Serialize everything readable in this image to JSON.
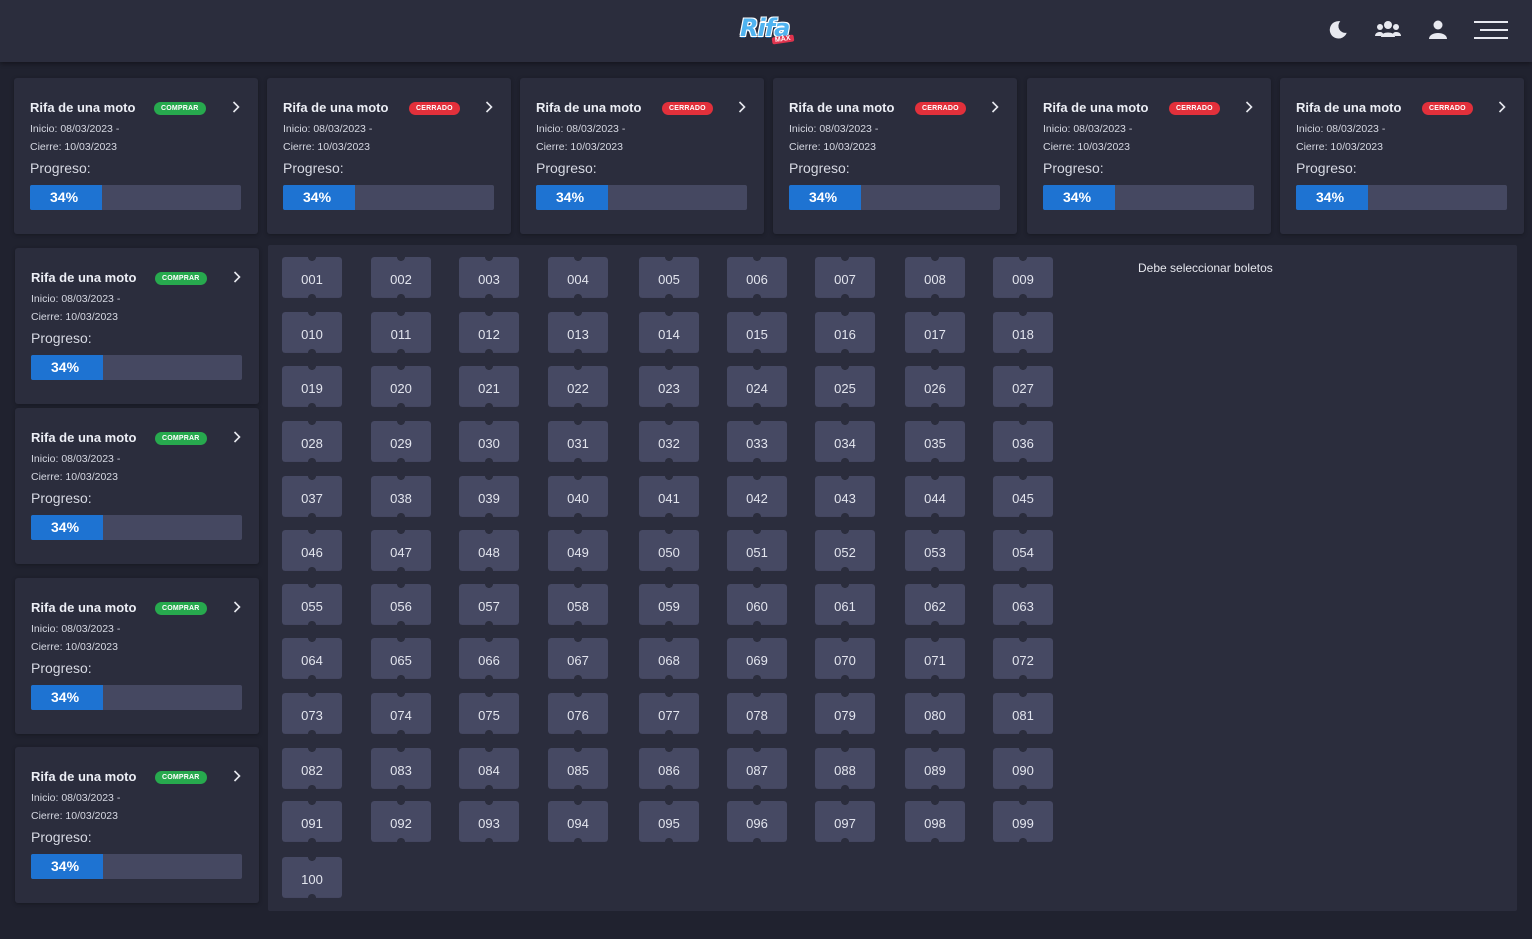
{
  "brand": {
    "logo_text": "Rifa",
    "logo_sub": "MAX"
  },
  "nav": {
    "icons": [
      "moon-icon",
      "users-icon",
      "user-icon",
      "menu-icon"
    ]
  },
  "raffles": [
    {
      "title": "Rifa de una moto",
      "status": "COMPRAR",
      "status_color": "#27a94e",
      "start": "Inicio: 08/03/2023 -",
      "end": "Cierre: 10/03/2023",
      "progress_label": "Progreso:",
      "progress_text": "34%",
      "progress": 0.34
    },
    {
      "title": "Rifa de una moto",
      "status": "CERRADO",
      "status_color": "#e2303b",
      "start": "Inicio: 08/03/2023 -",
      "end": "Cierre: 10/03/2023",
      "progress_label": "Progreso:",
      "progress_text": "34%",
      "progress": 0.34
    },
    {
      "title": "Rifa de una moto",
      "status": "CERRADO",
      "status_color": "#e2303b",
      "start": "Inicio: 08/03/2023 -",
      "end": "Cierre: 10/03/2023",
      "progress_label": "Progreso:",
      "progress_text": "34%",
      "progress": 0.34
    },
    {
      "title": "Rifa de una moto",
      "status": "CERRADO",
      "status_color": "#e2303b",
      "start": "Inicio: 08/03/2023 -",
      "end": "Cierre: 10/03/2023",
      "progress_label": "Progreso:",
      "progress_text": "34%",
      "progress": 0.34
    },
    {
      "title": "Rifa de una moto",
      "status": "CERRADO",
      "status_color": "#e2303b",
      "start": "Inicio: 08/03/2023 -",
      "end": "Cierre: 10/03/2023",
      "progress_label": "Progreso:",
      "progress_text": "34%",
      "progress": 0.34
    },
    {
      "title": "Rifa de una moto",
      "status": "CERRADO",
      "status_color": "#e2303b",
      "start": "Inicio: 08/03/2023 -",
      "end": "Cierre: 10/03/2023",
      "progress_label": "Progreso:",
      "progress_text": "34%",
      "progress": 0.34
    },
    {
      "title": "Rifa de una moto",
      "status": "COMPRAR",
      "status_color": "#27a94e",
      "start": "Inicio: 08/03/2023 -",
      "end": "Cierre: 10/03/2023",
      "progress_label": "Progreso:",
      "progress_text": "34%",
      "progress": 0.34
    },
    {
      "title": "Rifa de una moto",
      "status": "COMPRAR",
      "status_color": "#27a94e",
      "start": "Inicio: 08/03/2023 -",
      "end": "Cierre: 10/03/2023",
      "progress_label": "Progreso:",
      "progress_text": "34%",
      "progress": 0.34
    },
    {
      "title": "Rifa de una moto",
      "status": "COMPRAR",
      "status_color": "#27a94e",
      "start": "Inicio: 08/03/2023 -",
      "end": "Cierre: 10/03/2023",
      "progress_label": "Progreso:",
      "progress_text": "34%",
      "progress": 0.34
    },
    {
      "title": "Rifa de una moto",
      "status": "COMPRAR",
      "status_color": "#27a94e",
      "start": "Inicio: 08/03/2023 -",
      "end": "Cierre: 10/03/2023",
      "progress_label": "Progreso:",
      "progress_text": "34%",
      "progress": 0.34
    }
  ],
  "tickets": [
    "001",
    "002",
    "003",
    "004",
    "005",
    "006",
    "007",
    "008",
    "009",
    "010",
    "011",
    "012",
    "013",
    "014",
    "015",
    "016",
    "017",
    "018",
    "019",
    "020",
    "021",
    "022",
    "023",
    "024",
    "025",
    "026",
    "027",
    "028",
    "029",
    "030",
    "031",
    "032",
    "033",
    "034",
    "035",
    "036",
    "037",
    "038",
    "039",
    "040",
    "041",
    "042",
    "043",
    "044",
    "045",
    "046",
    "047",
    "048",
    "049",
    "050",
    "051",
    "052",
    "053",
    "054",
    "055",
    "056",
    "057",
    "058",
    "059",
    "060",
    "061",
    "062",
    "063",
    "064",
    "065",
    "066",
    "067",
    "068",
    "069",
    "070",
    "071",
    "072",
    "073",
    "074",
    "075",
    "076",
    "077",
    "078",
    "079",
    "080",
    "081",
    "082",
    "083",
    "084",
    "085",
    "086",
    "087",
    "088",
    "089",
    "090",
    "091",
    "092",
    "093",
    "094",
    "095",
    "096",
    "097",
    "098",
    "099",
    "100"
  ],
  "selection_hint": "Debe seleccionar boletos"
}
